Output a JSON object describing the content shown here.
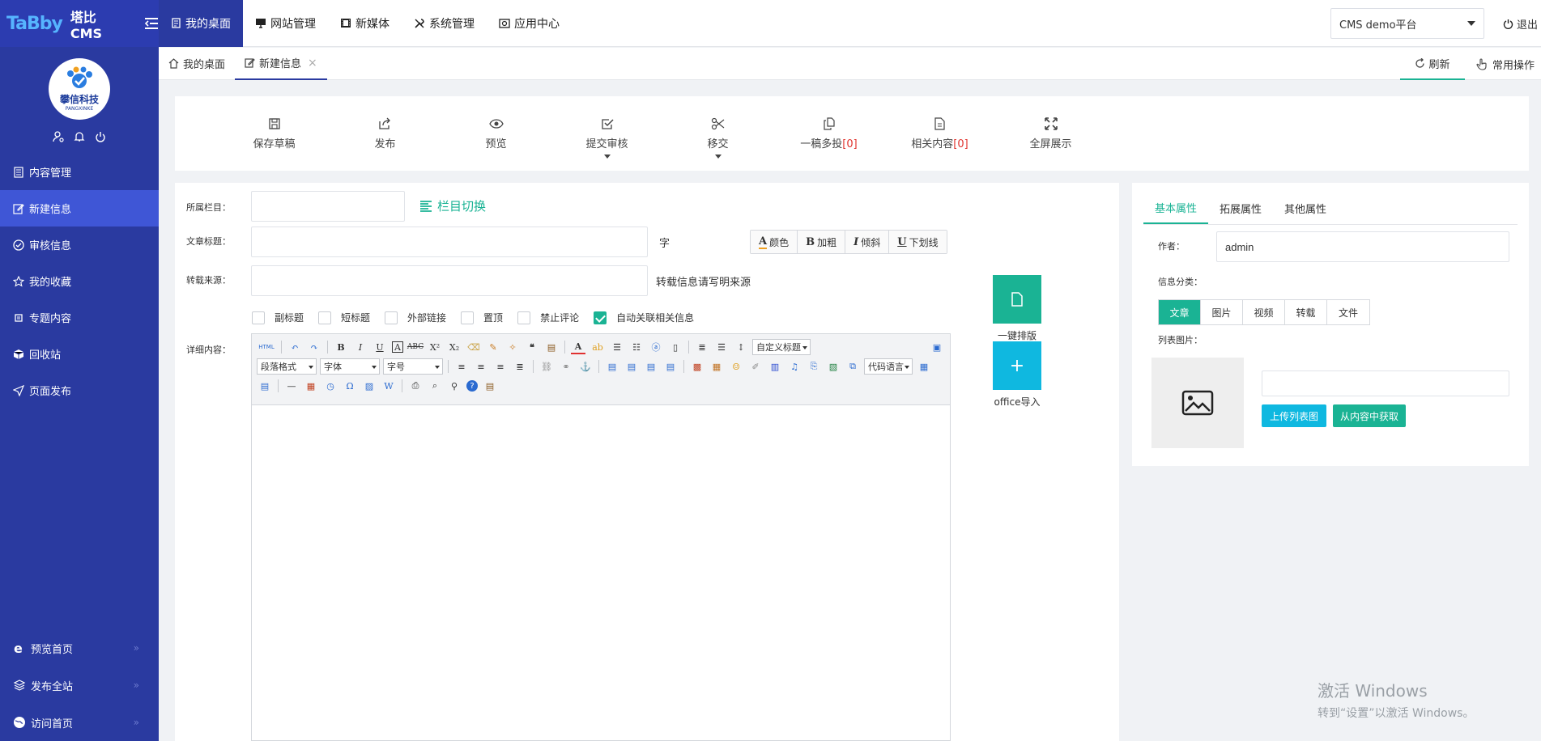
{
  "app": {
    "logo_badge": "TaBby",
    "title": "塔比CMS"
  },
  "sidebar": {
    "avatar_name": "攀信科技",
    "avatar_sub": "PANGXINKE",
    "items": [
      {
        "label": "内容管理",
        "icon": "list-icon"
      },
      {
        "label": "新建信息",
        "icon": "edit-icon",
        "active": true
      },
      {
        "label": "审核信息",
        "icon": "check-circle-icon"
      },
      {
        "label": "我的收藏",
        "icon": "star-icon"
      },
      {
        "label": "专题内容",
        "icon": "square-icon"
      },
      {
        "label": "回收站",
        "icon": "cube-icon"
      },
      {
        "label": "页面发布",
        "icon": "send-icon"
      }
    ],
    "bottom_items": [
      {
        "label": "预览首页",
        "icon": "ie-icon"
      },
      {
        "label": "发布全站",
        "icon": "layers-icon"
      },
      {
        "label": "访问首页",
        "icon": "globe-icon"
      }
    ]
  },
  "topnav": {
    "tabs": [
      {
        "label": "我的桌面",
        "active": true
      },
      {
        "label": "网站管理"
      },
      {
        "label": "新媒体"
      },
      {
        "label": "系统管理"
      },
      {
        "label": "应用中心"
      }
    ],
    "platform": "CMS demo平台",
    "logout": "退出"
  },
  "tabstrip": {
    "tabs": [
      {
        "label": "我的桌面"
      },
      {
        "label": "新建信息",
        "active": true
      }
    ],
    "close": "×",
    "refresh": "刷新",
    "common_ops": "常用操作"
  },
  "toolbar": {
    "save_draft": "保存草稿",
    "publish": "发布",
    "preview": "预览",
    "submit_review": "提交审核",
    "move": "移交",
    "multi_post": "一稿多投",
    "multi_post_count": "[0]",
    "related": "相关内容",
    "related_count": "[0]",
    "fullscreen": "全屏展示"
  },
  "form": {
    "column_label": "所属栏目：",
    "column_switch": "栏目切换",
    "title_label": "文章标题：",
    "title_unit": "字",
    "fmt_color": "颜色",
    "fmt_bold": "加粗",
    "fmt_italic": "倾斜",
    "fmt_underline": "下划线",
    "source_label": "转载来源：",
    "source_hint": "转载信息请写明来源",
    "checks": [
      {
        "label": "副标题",
        "checked": false
      },
      {
        "label": "短标题",
        "checked": false
      },
      {
        "label": "外部链接",
        "checked": false
      },
      {
        "label": "置顶",
        "checked": false
      },
      {
        "label": "禁止评论",
        "checked": false
      },
      {
        "label": "自动关联相关信息",
        "checked": true
      }
    ],
    "detail_label": "详细内容："
  },
  "editor": {
    "html_btn": "HTML",
    "custom_title": "自定义标题",
    "paragraph": "段落格式",
    "font": "字体",
    "size": "字号",
    "code_lang": "代码语言"
  },
  "actions": {
    "one_click_layout": "一键排版",
    "office_import": "office导入",
    "plus": "+"
  },
  "props": {
    "tabs": [
      {
        "label": "基本属性",
        "active": true
      },
      {
        "label": "拓展属性"
      },
      {
        "label": "其他属性"
      }
    ],
    "author_label": "作者：",
    "author_value": "admin",
    "category_label": "信息分类：",
    "categories": [
      {
        "label": "文章",
        "active": true
      },
      {
        "label": "图片"
      },
      {
        "label": "视频"
      },
      {
        "label": "转载"
      },
      {
        "label": "文件"
      }
    ],
    "list_image_label": "列表图片：",
    "upload_btn": "上传列表图",
    "from_content_btn": "从内容中获取"
  },
  "watermark": {
    "line1": "激活 Windows",
    "line2": "转到“设置”以激活 Windows。"
  },
  "colors": {
    "sidebar": "#2a3aa0",
    "sidebar_active": "#3f56d6",
    "accent": "#1ab394",
    "cyan": "#0fb8e0",
    "red": "#e0322d"
  }
}
